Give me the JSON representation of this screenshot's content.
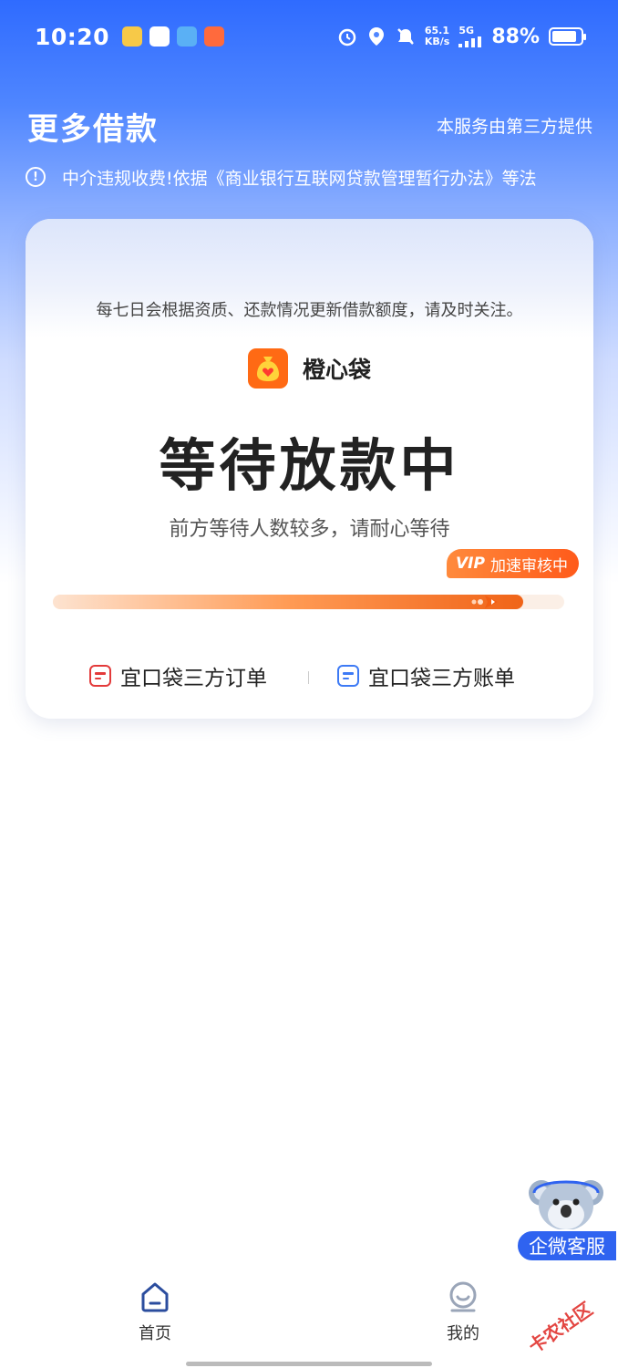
{
  "status_bar": {
    "time": "10:20",
    "net_speed_value": "65.1",
    "net_speed_unit": "KB/s",
    "signal_label": "5G",
    "battery": "88%",
    "battery_level": 0.88
  },
  "header": {
    "title": "更多借款",
    "provider_note": "本服务由第三方提供",
    "notice": "中介违规收费!依据《商业银行互联网贷款管理暂行办法》等法"
  },
  "card": {
    "sub_note": "每七日会根据资质、还款情况更新借款额度，请及时关注。",
    "brand_name": "橙心袋",
    "status_title": "等待放款中",
    "wait_note": "前方等待人数较多，请耐心等待",
    "vip_tag": "VIP",
    "vip_text": "加速审核中",
    "progress": 0.92,
    "link_orders": "宜口袋三方订单",
    "link_bills": "宜口袋三方账单"
  },
  "floating": {
    "service_label": "企微客服"
  },
  "bottom_nav": {
    "home_label": "首页",
    "mine_label": "我的"
  },
  "watermark": "卡农社区",
  "colors": {
    "primary_blue": "#2f6bff",
    "orange": "#ff6a14",
    "order_red": "#e33a3a",
    "bill_blue": "#3d7af5"
  }
}
